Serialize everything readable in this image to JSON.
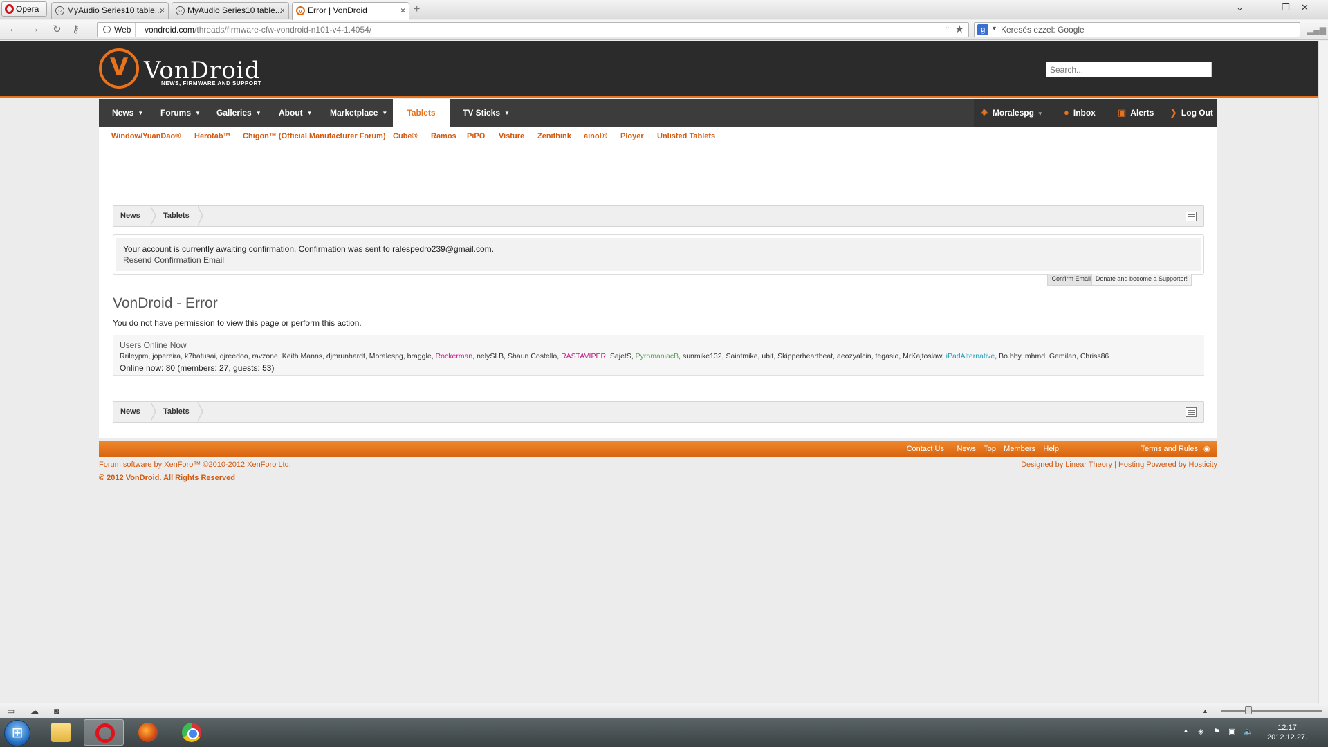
{
  "browser": {
    "opera_label": "Opera",
    "tabs": [
      {
        "label": "MyAudio Series10 table...",
        "close": "×"
      },
      {
        "label": "MyAudio Series10 table...",
        "close": "×"
      },
      {
        "label": "Error | VonDroid",
        "close": "×"
      }
    ],
    "web_label": "Web",
    "url_host": "vondroid.com",
    "url_path": "/threads/firmware-cfw-vondroid-n101-v4-1.4054/",
    "search_placeholder": "Keresés ezzel: Google"
  },
  "site": {
    "logo_name": "VonDroid",
    "tagline": "NEWS, FIRMWARE AND SUPPORT",
    "search_placeholder": "Search..."
  },
  "nav": {
    "tabs": [
      "News",
      "Forums",
      "Galleries",
      "About",
      "Marketplace",
      "Tablets",
      "TV Sticks"
    ],
    "selected": "Tablets",
    "user": "Moralespg",
    "inbox": "Inbox",
    "alerts": "Alerts",
    "logout": "Log Out"
  },
  "subnav": [
    "Window/YuanDao®",
    "Herotab™",
    "Chigon™ (Official Manufacturer Forum)",
    "Cube®",
    "Ramos",
    "PiPO",
    "Visture",
    "Zenithink",
    "ainol®",
    "Ployer",
    "Unlisted Tablets"
  ],
  "breadcrumb": [
    "News",
    "Tablets"
  ],
  "notice": {
    "text": "Your account is currently awaiting confirmation. Confirmation was sent to ralespedro239@gmail.com.",
    "link": "Resend Confirmation Email",
    "tabs": [
      "Confirm Email",
      "Donate and become a Supporter!"
    ]
  },
  "error": {
    "title": "VonDroid - Error",
    "message": "You do not have permission to view this page or perform this action."
  },
  "online": {
    "heading": "Users Online Now",
    "users": [
      {
        "name": "Rrileypm"
      },
      {
        "name": "jopereira"
      },
      {
        "name": "k7batusai"
      },
      {
        "name": "djreedoo"
      },
      {
        "name": "ravzone"
      },
      {
        "name": "Keith Manns"
      },
      {
        "name": "djmrunhardt"
      },
      {
        "name": "Moralespg"
      },
      {
        "name": "braggle"
      },
      {
        "name": "Rockerman",
        "style": "pink"
      },
      {
        "name": "nelySLB"
      },
      {
        "name": "Shaun Costello"
      },
      {
        "name": "RASTAVIPER",
        "style": "pink"
      },
      {
        "name": "SajetS"
      },
      {
        "name": "PyromaniacB",
        "style": "green"
      },
      {
        "name": "sunmike132"
      },
      {
        "name": "Saintmike"
      },
      {
        "name": "ubit"
      },
      {
        "name": "Skipperheartbeat"
      },
      {
        "name": "aeozyalcin"
      },
      {
        "name": "tegasio"
      },
      {
        "name": "MrKajtoslaw"
      },
      {
        "name": "iPadAlternative",
        "style": "teal"
      },
      {
        "name": "Bo.bby"
      },
      {
        "name": "mhmd"
      },
      {
        "name": "Gemilan"
      },
      {
        "name": "Chriss86"
      }
    ],
    "count": "Online now: 80 (members: 27, guests: 53)"
  },
  "footer": {
    "links": [
      "Contact Us",
      "News",
      "Top",
      "Members",
      "Help",
      "Terms and Rules"
    ],
    "software": "Forum software by XenForo™ ©2010-2012 XenForo Ltd.",
    "copyright": "© 2012 VonDroid. All Rights Reserved",
    "credits": "Designed by Linear Theory | Hosting Powered by Hosticity"
  },
  "taskbar": {
    "time": "12:17",
    "date": "2012.12.27."
  }
}
